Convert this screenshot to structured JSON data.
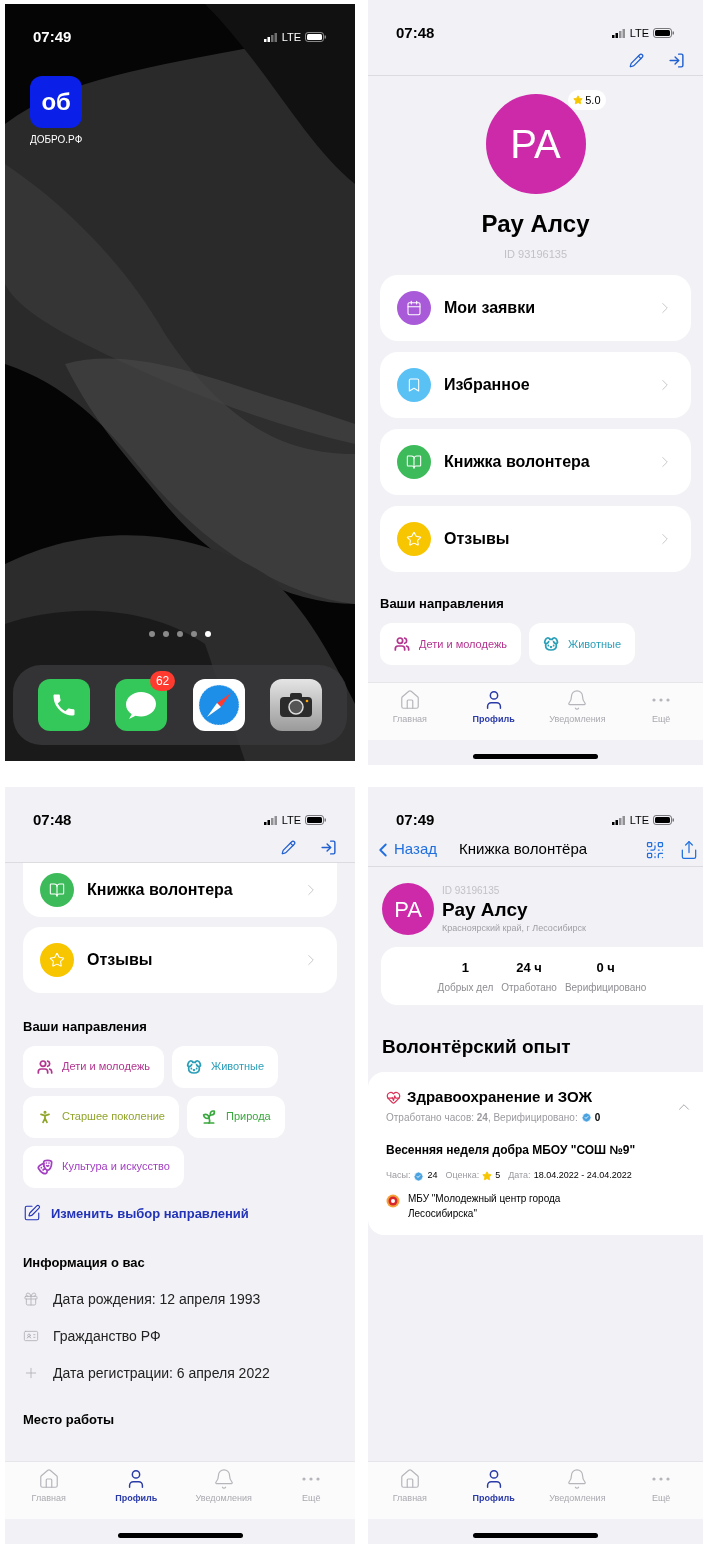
{
  "home_screen": {
    "status_bar": {
      "time": "07:49",
      "network": "LTE"
    },
    "apps": [
      {
        "label": "ДОБРО.РФ",
        "icon_text": "об"
      }
    ],
    "page_dots": [
      {
        "selected": false
      },
      {
        "selected": false
      },
      {
        "selected": false
      },
      {
        "selected": false
      },
      {
        "selected": true
      }
    ],
    "dock": [
      {
        "kind": "phone"
      },
      {
        "kind": "messages",
        "badge": "62"
      },
      {
        "kind": "safari"
      },
      {
        "kind": "camera"
      }
    ]
  },
  "profile": {
    "status_bar": {
      "time": "07:48",
      "network": "LTE"
    },
    "avatar_initials": "PA",
    "rating": "5.0",
    "name": "Рау Алсу",
    "id": "ID 93196135",
    "menu": [
      {
        "label": "Мои заявки",
        "kind": "calendar",
        "color": "#a85ad8"
      },
      {
        "label": "Избранное",
        "kind": "bookmark",
        "color": "#5ac1f5"
      },
      {
        "label": "Книжка волонтера",
        "kind": "book",
        "color": "#3dbb5a"
      },
      {
        "label": "Отзывы",
        "kind": "star",
        "color": "#f7c600"
      }
    ],
    "directions_title": "Ваши направления",
    "directions": [
      {
        "label": "Дети и молодежь",
        "kind": "children",
        "color": "#b3348f"
      },
      {
        "label": "Животные",
        "kind": "animals",
        "color": "#2b9fb8"
      }
    ],
    "tabs": [
      {
        "label": "Главная",
        "kind": "home",
        "selected": false
      },
      {
        "label": "Профиль",
        "kind": "profile",
        "selected": true
      },
      {
        "label": "Уведомления",
        "kind": "bell",
        "selected": false
      },
      {
        "label": "Ещё",
        "kind": "more",
        "selected": false
      }
    ]
  },
  "profile_scrolled": {
    "status_bar": {
      "time": "07:48",
      "network": "LTE"
    },
    "menu": [
      {
        "label": "Книжка волонтера",
        "kind": "book",
        "color": "#3dbb5a"
      },
      {
        "label": "Отзывы",
        "kind": "star",
        "color": "#f7c600"
      }
    ],
    "directions_title": "Ваши направления",
    "directions": [
      {
        "label": "Дети и молодежь",
        "kind": "children",
        "color": "#b3348f"
      },
      {
        "label": "Животные",
        "kind": "animals",
        "color": "#2b9fb8"
      },
      {
        "label": "Старшее поколение",
        "kind": "elderly",
        "color": "#8fa52b"
      },
      {
        "label": "Природа",
        "kind": "nature",
        "color": "#3ba83f"
      },
      {
        "label": "Культура и искусство",
        "kind": "culture",
        "color": "#a340c2"
      }
    ],
    "change_link": "Изменить выбор направлений",
    "info_title": "Информация о вас",
    "info": [
      {
        "label": "Дата рождения: 12 апреля 1993",
        "kind": "gift"
      },
      {
        "label": "Гражданство РФ",
        "kind": "document"
      },
      {
        "label": "Дата регистрации: 6 апреля 2022",
        "kind": "plus"
      }
    ],
    "work_title": "Место работы",
    "tabs": [
      {
        "label": "Главная",
        "kind": "home",
        "selected": false
      },
      {
        "label": "Профиль",
        "kind": "profile",
        "selected": true
      },
      {
        "label": "Уведомления",
        "kind": "bell",
        "selected": false
      },
      {
        "label": "Ещё",
        "kind": "more",
        "selected": false
      }
    ]
  },
  "volunteer_book": {
    "status_bar": {
      "time": "07:49",
      "network": "LTE"
    },
    "back": "Назад",
    "title": "Книжка волонтёра",
    "avatar_initials": "PA",
    "id": "ID 93196135",
    "name": "Рау Алсу",
    "region": "Красноярский край, г Лесосибирск",
    "stats": [
      {
        "value": "1",
        "label": "Добрых дел"
      },
      {
        "value": "24 ч",
        "label": "Отработано"
      },
      {
        "value": "0 ч",
        "label": "Верифицировано"
      }
    ],
    "section_title": "Волонтёрский опыт",
    "category": {
      "title": "Здравоохранение и ЗОЖ",
      "summary": "Отработано часов: **24**, Верифицировано:",
      "verified": "0",
      "expanded": true,
      "event": {
        "title": "Весенняя неделя добра МБОУ \"СОШ №9\"",
        "meta": [
          {
            "label": "Часы:",
            "value": "24",
            "kind": "verified"
          },
          {
            "label": "Оценка:",
            "value": "5",
            "kind": "star"
          },
          {
            "label": "Дата:",
            "value": "18.04.2022 - 24.04.2022",
            "kind": "plain"
          }
        ],
        "organizer": "МБУ \"Молодежный центр города Лесосибирска\""
      }
    },
    "tabs": [
      {
        "label": "Главная",
        "kind": "home",
        "selected": false
      },
      {
        "label": "Профиль",
        "kind": "profile",
        "selected": true
      },
      {
        "label": "Уведомления",
        "kind": "bell",
        "selected": false
      },
      {
        "label": "Ещё",
        "kind": "more",
        "selected": false
      }
    ]
  }
}
